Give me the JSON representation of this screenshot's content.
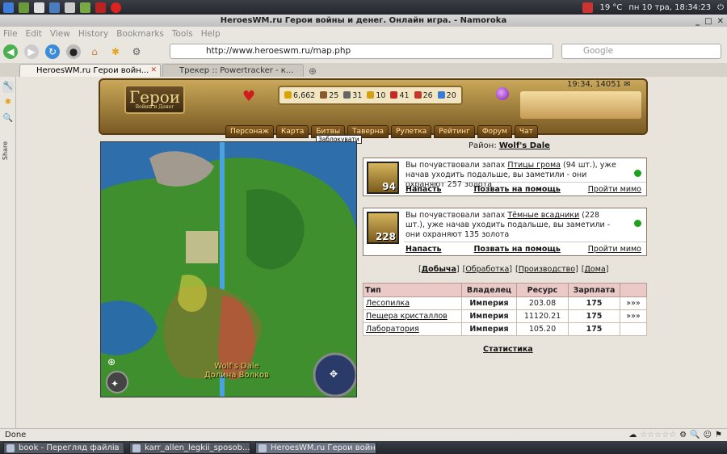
{
  "syspanel": {
    "weather": "19 °C",
    "datetime": "пн 10 тра, 18:34:23"
  },
  "window": {
    "title": "HeroesWM.ru Герои войны и денег. Онлайн игра. - Namoroka"
  },
  "menu": [
    "File",
    "Edit",
    "View",
    "History",
    "Bookmarks",
    "Tools",
    "Help"
  ],
  "navbar": {
    "url": "http://www.heroeswm.ru/map.php",
    "search_placeholder": "Google"
  },
  "tabs": [
    {
      "label": "HeroesWM.ru Герои войн...",
      "active": true
    },
    {
      "label": "Трекер :: Powertracker - к...",
      "active": false
    }
  ],
  "sidebar": {
    "share_label": "Share"
  },
  "game": {
    "logo_text": "Герои",
    "logo_sub": "Войны и Денег",
    "clock": "19:34, 14051",
    "resources": [
      {
        "icon": "gold-icon",
        "value": "6,662",
        "color": "#d9a400"
      },
      {
        "icon": "wood-icon",
        "value": "25",
        "color": "#8b5a2b"
      },
      {
        "icon": "ore-icon",
        "value": "31",
        "color": "#666666"
      },
      {
        "icon": "mercury-icon",
        "value": "10",
        "color": "#d4a017"
      },
      {
        "icon": "sulfur-icon",
        "value": "41",
        "color": "#c62828"
      },
      {
        "icon": "crystal-icon",
        "value": "26",
        "color": "#c0392b"
      },
      {
        "icon": "gem-icon",
        "value": "20",
        "color": "#3a7bd5"
      }
    ],
    "nav": [
      "Персонаж",
      "Карта",
      "Битвы",
      "Таверна",
      "Рулетка",
      "Рейтинг",
      "Форум",
      "Чат"
    ],
    "tooltip": "Заблокувати",
    "map_label_en": "Wolf's Dale",
    "map_label_ru": "Долина Волков"
  },
  "district": {
    "label": "Район:",
    "name": "Wolf's Dale"
  },
  "monsters": [
    {
      "count": "94",
      "text_pre": "Вы почувствовали запах ",
      "creature": "Птицы грома",
      "text_post": " (94 шт.), уже начав уходить подальше, вы заметили - они охраняют 257 золота",
      "attack": "Напасть",
      "call_help": "Позвать на помощь",
      "pass": "Пройти мимо"
    },
    {
      "count": "228",
      "text_pre": "Вы почувствовали запах ",
      "creature": "Тёмные всадники",
      "text_post": " (228 шт.), уже начав уходить подальше, вы заметили - они охраняют 135 золота",
      "attack": "Напасть",
      "call_help": "Позвать на помощь",
      "pass": "Пройти мимо"
    }
  ],
  "filters": [
    "Добыча",
    "Обработка",
    "Производство",
    "Дома"
  ],
  "table": {
    "headers": [
      "Тип",
      "Владелец",
      "Ресурс",
      "Зарплата",
      ""
    ],
    "rows": [
      {
        "type": "Лесопилка",
        "owner": "Империя",
        "resource": "203.08",
        "salary": "175",
        "more": "»»»"
      },
      {
        "type": "Пещера кристаллов",
        "owner": "Империя",
        "resource": "11120.21",
        "salary": "175",
        "more": "»»»"
      },
      {
        "type": "Лаборатория",
        "owner": "Империя",
        "resource": "105.20",
        "salary": "175",
        "more": ""
      }
    ]
  },
  "stats_link": "Статистика",
  "status": "Done",
  "taskbar": [
    {
      "label": "book - Перегляд файлів",
      "active": false
    },
    {
      "label": "karr_allen_legkii_sposob...",
      "active": false
    },
    {
      "label": "HeroesWM.ru Герои войн...",
      "active": true
    }
  ]
}
